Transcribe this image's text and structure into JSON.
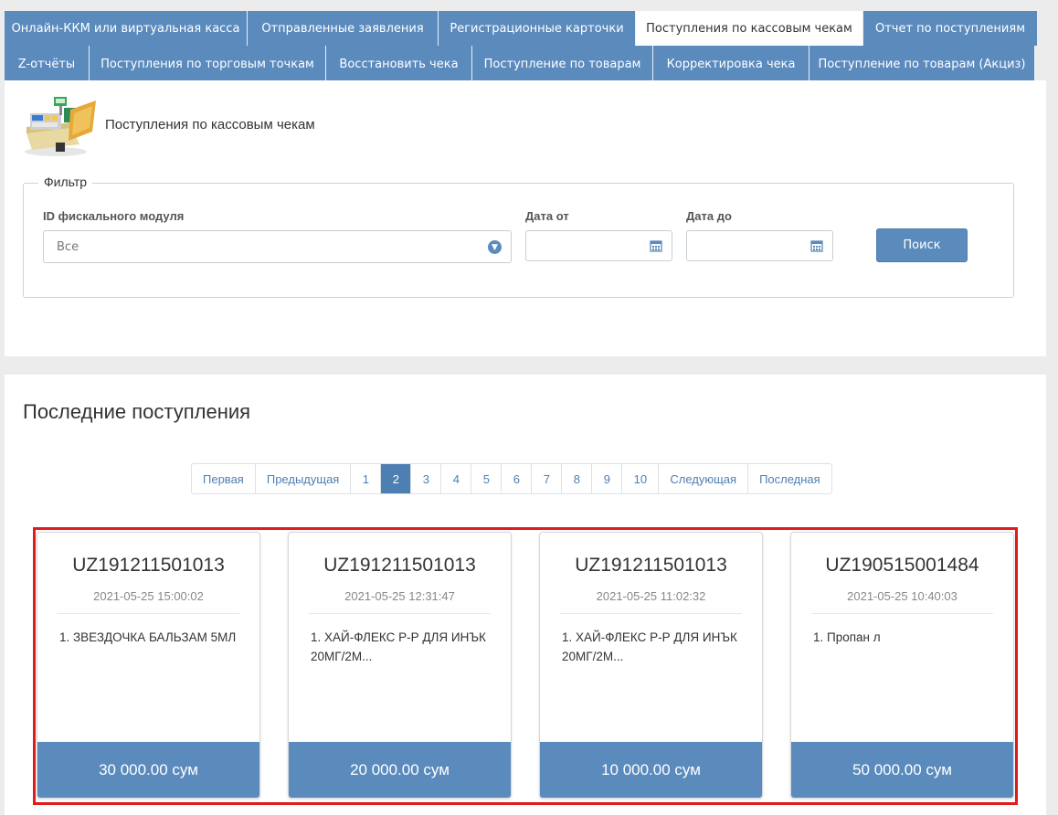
{
  "tabs_row1": [
    {
      "label": "Онлайн-ККМ или виртуальная касса",
      "active": false
    },
    {
      "label": "Отправленные заявления",
      "active": false
    },
    {
      "label": "Регистрационные карточки",
      "active": false
    },
    {
      "label": "Поступления по кассовым чекам",
      "active": true
    },
    {
      "label": "Отчет по поступлениям",
      "active": false
    }
  ],
  "tabs_row2": [
    {
      "label": "Z-отчёты"
    },
    {
      "label": "Поступления по торговым точкам"
    },
    {
      "label": "Восстановить чека"
    },
    {
      "label": "Поступление по товарам"
    },
    {
      "label": "Корректировка чека"
    },
    {
      "label": "Поступление по товарам (Акциз)"
    }
  ],
  "header": {
    "title": "Поступления по кассовым чекам",
    "icon": "cash-register-icon"
  },
  "filter": {
    "legend": "Фильтр",
    "module_label": "ID фискального модуля",
    "module_value": "Все",
    "date_from_label": "Дата от",
    "date_to_label": "Дата до",
    "date_from_value": "",
    "date_to_value": "",
    "search_label": "Поиск"
  },
  "list": {
    "title": "Последние поступления",
    "pagination": {
      "first": "Первая",
      "prev": "Предыдущая",
      "pages": [
        "1",
        "2",
        "3",
        "4",
        "5",
        "6",
        "7",
        "8",
        "9",
        "10"
      ],
      "current": "2",
      "next": "Следующая",
      "last": "Последная"
    },
    "cards": [
      {
        "id": "UZ191211501013",
        "date": "2021-05-25 15:00:02",
        "item": "1. ЗВЕЗДОЧКА БАЛЬЗАМ 5МЛ",
        "amount": "30 000.00 сум"
      },
      {
        "id": "UZ191211501013",
        "date": "2021-05-25 12:31:47",
        "item": "1. ХАЙ-ФЛЕКС Р-Р ДЛЯ ИНЪК 20МГ/2М...",
        "amount": "20 000.00 сум"
      },
      {
        "id": "UZ191211501013",
        "date": "2021-05-25 11:02:32",
        "item": "1. ХАЙ-ФЛЕКС Р-Р ДЛЯ ИНЪК 20МГ/2М...",
        "amount": "10 000.00 сум"
      },
      {
        "id": "UZ190515001484",
        "date": "2021-05-25 10:40:03",
        "item": "1. Пропан л",
        "amount": "50 000.00 сум"
      }
    ]
  },
  "colors": {
    "accent": "#5b8bbd",
    "highlight": "#e01c1c",
    "page_bg": "#ececec"
  }
}
